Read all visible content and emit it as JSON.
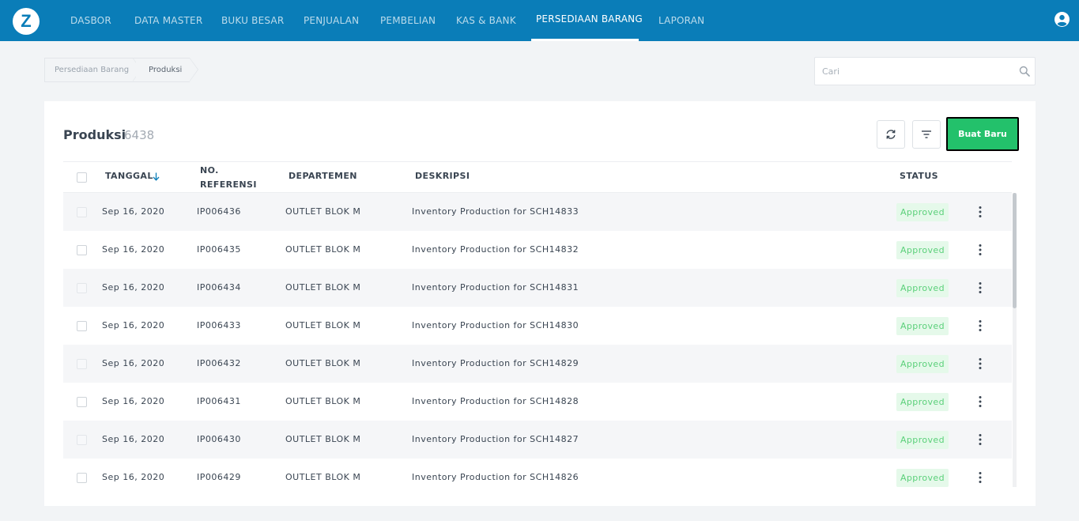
{
  "nav": {
    "logo": "Z",
    "items": [
      {
        "label": "DASBOR"
      },
      {
        "label": "DATA MASTER"
      },
      {
        "label": "BUKU BESAR"
      },
      {
        "label": "PENJUALAN"
      },
      {
        "label": "PEMBELIAN"
      },
      {
        "label": "KAS & BANK"
      },
      {
        "label": "PERSEDIAAN BARANG"
      },
      {
        "label": "LAPORAN"
      }
    ],
    "active": "PERSEDIAAN BARANG",
    "user_icon": "user-circle-icon"
  },
  "breadcrumb": [
    "Persediaan Barang",
    "Produksi"
  ],
  "search": {
    "placeholder": "Cari",
    "value": "",
    "icon": "search-icon"
  },
  "card": {
    "title": "Produksi",
    "count": "6438",
    "refresh_icon": "refresh-icon",
    "filter_icon": "filter-icon",
    "new_button": "Buat Baru"
  },
  "table": {
    "headers": {
      "date": "TANGGAL",
      "ref": "NO. REFERENSI",
      "dept": "DEPARTEMEN",
      "desc": "DESKRIPSI",
      "status": "STATUS"
    },
    "sort_icon": "arrow-down-icon",
    "rows": [
      {
        "date": "Sep 16, 2020",
        "ref": "IP006436",
        "dept": "OUTLET BLOK M",
        "desc": "Inventory Production for SCH14833",
        "status": "Approved"
      },
      {
        "date": "Sep 16, 2020",
        "ref": "IP006435",
        "dept": "OUTLET BLOK M",
        "desc": "Inventory Production for SCH14832",
        "status": "Approved"
      },
      {
        "date": "Sep 16, 2020",
        "ref": "IP006434",
        "dept": "OUTLET BLOK M",
        "desc": "Inventory Production for SCH14831",
        "status": "Approved"
      },
      {
        "date": "Sep 16, 2020",
        "ref": "IP006433",
        "dept": "OUTLET BLOK M",
        "desc": "Inventory Production for SCH14830",
        "status": "Approved"
      },
      {
        "date": "Sep 16, 2020",
        "ref": "IP006432",
        "dept": "OUTLET BLOK M",
        "desc": "Inventory Production for SCH14829",
        "status": "Approved"
      },
      {
        "date": "Sep 16, 2020",
        "ref": "IP006431",
        "dept": "OUTLET BLOK M",
        "desc": "Inventory Production for SCH14828",
        "status": "Approved"
      },
      {
        "date": "Sep 16, 2020",
        "ref": "IP006430",
        "dept": "OUTLET BLOK M",
        "desc": "Inventory Production for SCH14827",
        "status": "Approved"
      },
      {
        "date": "Sep 16, 2020",
        "ref": "IP006429",
        "dept": "OUTLET BLOK M",
        "desc": "Inventory Production for SCH14826",
        "status": "Approved"
      }
    ]
  },
  "colors": {
    "nav_bg": "#0a7db8",
    "primary_button": "#23c16b",
    "status_bg": "#e5f9ea",
    "status_text": "#5bd07a"
  }
}
